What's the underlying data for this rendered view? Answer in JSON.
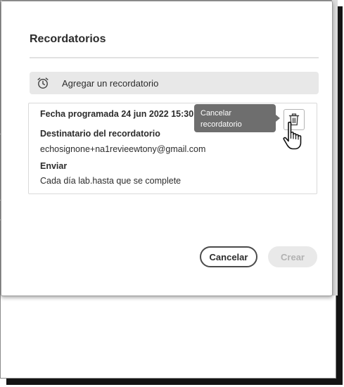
{
  "dialog": {
    "title": "Recordatorios",
    "add_reminder_label": "Agregar un recordatorio",
    "add_reminder_icon": "alarm-clock-icon"
  },
  "reminder": {
    "scheduled_label": "Fecha programada 24 jun 2022 15:30",
    "recipient_heading": "Destinatario del recordatorio",
    "recipient_email": "echosignone+na1revieewtony@gmail.com",
    "send_heading": "Enviar",
    "send_value": "Cada día lab.hasta que se complete",
    "delete_icon": "trash-icon"
  },
  "tooltip": {
    "line1": "Cancelar",
    "line2": "recordatorio"
  },
  "footer": {
    "cancel_label": "Cancelar",
    "create_label": "Crear"
  }
}
